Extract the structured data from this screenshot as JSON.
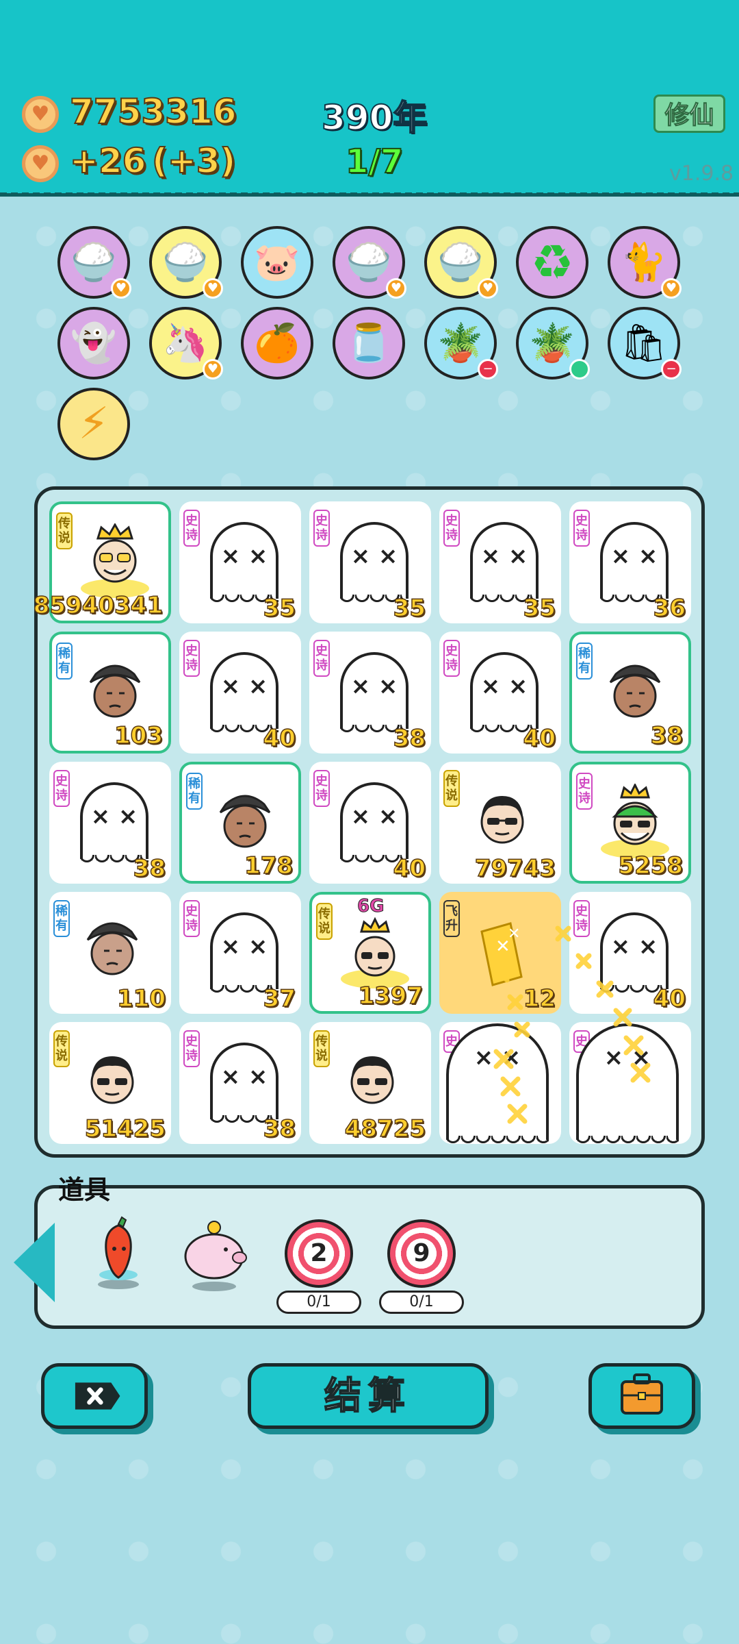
{
  "header": {
    "coins": "7753316",
    "income": "+26",
    "income_bonus": "(+3)",
    "year": "390年",
    "wave": "1/7",
    "cultivate_button": "修仙",
    "version": "v1.9.8"
  },
  "symbols_row1": [
    "rice-bowl-icon",
    "rice-bowl-icon",
    "piggy-bank-icon",
    "rice-bowl-icon",
    "rice-bowl-icon",
    "recycle-icon",
    "cat-icon"
  ],
  "symbols_row2": [
    "ghost-card-icon",
    "unicorn-icon",
    "orange-eyepatch-icon",
    "milk-jar-icon",
    "flower-pot-icon",
    "flower-pot-icon",
    "garbage-bag-icon"
  ],
  "symbols_row3": [
    "lightning-icon"
  ],
  "board": {
    "cells": [
      {
        "tag": "传说",
        "value": "85940341"
      },
      {
        "tag": "史诗",
        "value": "35"
      },
      {
        "tag": "史诗",
        "value": "35"
      },
      {
        "tag": "史诗",
        "value": "35"
      },
      {
        "tag": "史诗",
        "value": "36"
      },
      {
        "tag": "稀有",
        "value": "103"
      },
      {
        "tag": "史诗",
        "value": "40"
      },
      {
        "tag": "史诗",
        "value": "38"
      },
      {
        "tag": "史诗",
        "value": "40"
      },
      {
        "tag": "稀有",
        "value": "38"
      },
      {
        "tag": "史诗",
        "value": "38"
      },
      {
        "tag": "稀有",
        "value": "178"
      },
      {
        "tag": "史诗",
        "value": "40"
      },
      {
        "tag": "传说",
        "value": "79743"
      },
      {
        "tag": "史诗",
        "value": "5258"
      },
      {
        "tag": "稀有",
        "value": "110"
      },
      {
        "tag": "史诗",
        "value": "37"
      },
      {
        "tag": "传说",
        "value": "1397",
        "badge": "6G"
      },
      {
        "tag": "飞升",
        "value": "12"
      },
      {
        "tag": "史诗",
        "value": "40"
      },
      {
        "tag": "传说",
        "value": "51425"
      },
      {
        "tag": "史诗",
        "value": "38"
      },
      {
        "tag": "传说",
        "value": "48725"
      },
      {
        "tag": "史",
        "value": ""
      },
      {
        "tag": "史",
        "value": ""
      }
    ]
  },
  "props": {
    "title": "道具",
    "items": [
      {
        "icon": "chili-pepper-icon"
      },
      {
        "icon": "piggy-bank-icon"
      },
      {
        "icon": "target-icon",
        "label": "2",
        "count": "0/1"
      },
      {
        "icon": "target-icon",
        "label": "9",
        "count": "0/1"
      }
    ]
  },
  "buttons": {
    "settle": "结算"
  },
  "colors": {
    "topbar": "#17c4c8",
    "accent": "#1ec7cc",
    "gold_text": "#ffcf2e"
  }
}
